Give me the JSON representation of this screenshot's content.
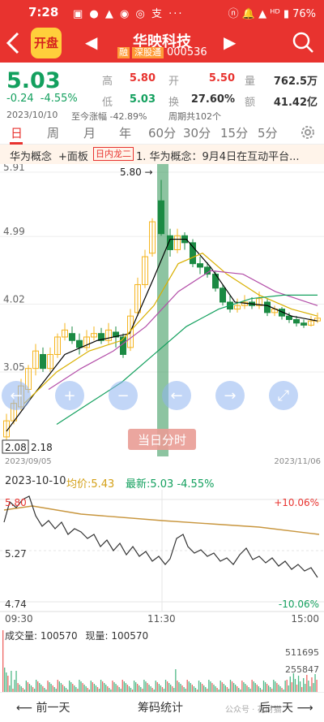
{
  "status_bar": {
    "time": "7:28",
    "left_icons": "▣ ● ▲ ◉ ◎ 支 ···",
    "right": "ⓝ 🔔 ▲ ᴴᴰ ▮ 76%"
  },
  "header": {
    "logo_text": "开盘",
    "stock_name": "华映科技",
    "tag_rong": "融",
    "tag_sgt": "深股通",
    "stock_code": "000536"
  },
  "quote": {
    "price": "5.03",
    "change": "-0.24",
    "change_pct": "-4.55%",
    "high_label": "高",
    "high": "5.80",
    "low_label": "低",
    "low": "5.03",
    "open_label": "开",
    "open": "5.50",
    "turnover_label": "换",
    "turnover": "27.60%",
    "volume_label": "量",
    "volume": "762.5万",
    "amount_label": "额",
    "amount": "41.42亿",
    "date": "2023/10/10",
    "range_info": "至今涨幅 -42.89%",
    "period_info": "周期共102个"
  },
  "tabs": [
    {
      "label": "日",
      "active": true
    },
    {
      "label": "周",
      "active": false
    },
    {
      "label": "月",
      "active": false
    },
    {
      "label": "年",
      "active": false
    },
    {
      "label": "60分",
      "active": false
    },
    {
      "label": "30分",
      "active": false
    },
    {
      "label": "15分",
      "active": false
    },
    {
      "label": "5分",
      "active": false
    }
  ],
  "news": {
    "concept": "华为概念",
    "board": "+面板",
    "badge": "日内龙二",
    "text": "1. 华为概念：9月4日在互动平台..."
  },
  "kchart": {
    "y_labels": [
      "5.91",
      "4.99",
      "4.02",
      "3.05"
    ],
    "high_mark": "5.80",
    "low_mark_a": "2.08",
    "low_mark_b": "2.18",
    "date_start": "2023/09/05",
    "date_end": "2023/11/06",
    "overlay_button": "当日分时",
    "colors": {
      "up": "#f5b41e",
      "down": "#1b8a43",
      "ma5": "#000000",
      "ma10": "#d9b000",
      "ma20": "#b34ea8",
      "ma30": "#13a05e"
    }
  },
  "intraday": {
    "date": "2023-10-10",
    "avg_label": "均价:5.43",
    "latest_label": "最新:5.03 -4.55%",
    "top_price": "5.80",
    "top_pct": "+10.06%",
    "mid_price": "5.27",
    "bottom_price": "4.74",
    "bottom_pct": "-10.06%",
    "time_start": "09:30",
    "time_mid": "11:30",
    "time_end": "15:00",
    "volume_label": "成交量: 100570",
    "current_volume_label": "现量: 100570",
    "vol_max": "511695",
    "vol_mid": "255847"
  },
  "bottom_bar": {
    "prev": "前一天",
    "chips": "筹码统计",
    "next": "后一天",
    "watermark": "公众号 · 花财猫"
  }
}
